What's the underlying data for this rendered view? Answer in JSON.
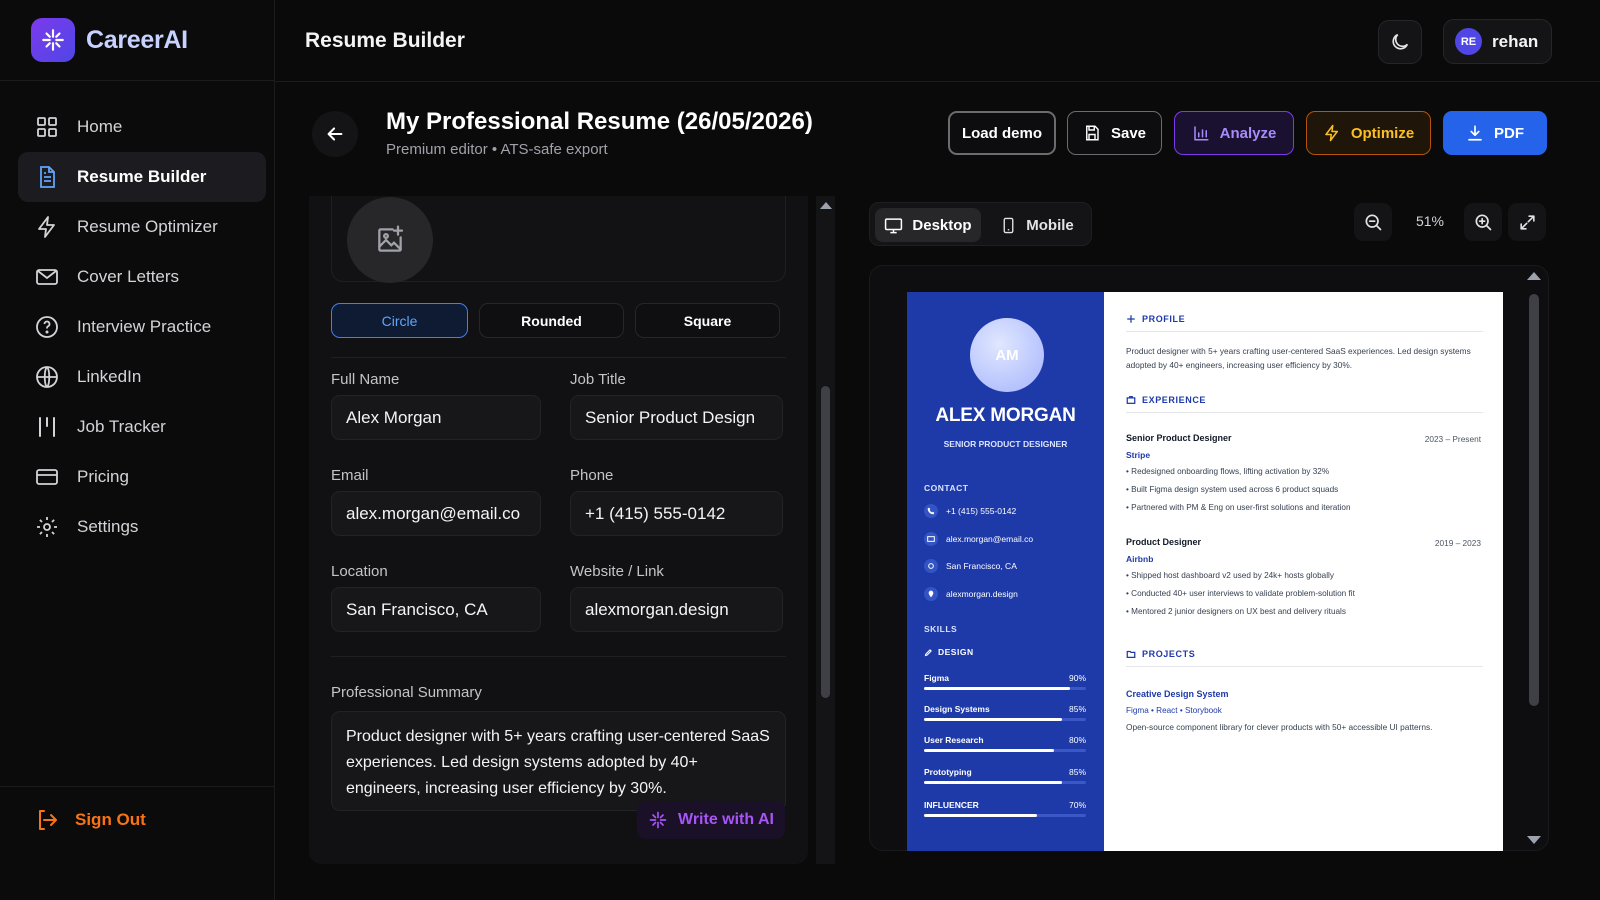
{
  "app": {
    "name": "CareerAI"
  },
  "sidebar": {
    "items": [
      {
        "label": "Home",
        "icon": "grid-icon"
      },
      {
        "label": "Resume Builder",
        "icon": "document-icon",
        "active": true
      },
      {
        "label": "Resume Optimizer",
        "icon": "lightning-icon"
      },
      {
        "label": "Cover Letters",
        "icon": "mail-icon"
      },
      {
        "label": "Interview Practice",
        "icon": "help-circle-icon"
      },
      {
        "label": "LinkedIn",
        "icon": "globe-icon"
      },
      {
        "label": "Job Tracker",
        "icon": "columns-icon"
      },
      {
        "label": "Pricing",
        "icon": "credit-card-icon"
      },
      {
        "label": "Settings",
        "icon": "gear-icon"
      }
    ],
    "sign_out": "Sign Out"
  },
  "header": {
    "title": "Resume Builder",
    "user": {
      "initials": "RE",
      "name": "rehan"
    }
  },
  "doc": {
    "title": "My Professional Resume (26/05/2026)",
    "subtitle": "Premium editor • ATS-safe export"
  },
  "actions": {
    "load_demo": "Load demo",
    "save": "Save",
    "analyze": "Analyze",
    "optimize": "Optimize",
    "pdf": "PDF"
  },
  "editor": {
    "photo_shapes": [
      "Circle",
      "Rounded",
      "Square"
    ],
    "selected_shape": "Circle",
    "fields": {
      "full_name": {
        "label": "Full Name",
        "value": "Alex Morgan"
      },
      "job_title": {
        "label": "Job Title",
        "value": "Senior Product Design"
      },
      "email": {
        "label": "Email",
        "value": "alex.morgan@email.co"
      },
      "phone": {
        "label": "Phone",
        "value": "+1 (415) 555-0142"
      },
      "location": {
        "label": "Location",
        "value": "San Francisco, CA"
      },
      "website": {
        "label": "Website / Link",
        "value": "alexmorgan.design"
      }
    },
    "summary": {
      "label": "Professional Summary",
      "value": "Product designer with 5+ years crafting user-centered SaaS experiences. Led design systems adopted by 40+ engineers, increasing user efficiency by 30%."
    },
    "write_ai": "Write with AI"
  },
  "preview": {
    "modes": [
      "Desktop",
      "Mobile"
    ],
    "active_mode": "Desktop",
    "zoom": "51%"
  },
  "resume": {
    "initials": "AM",
    "name": "ALEX MORGAN",
    "title": "SENIOR PRODUCT DESIGNER",
    "contact_heading": "CONTACT",
    "contacts": [
      {
        "icon": "phone-icon",
        "text": "+1 (415) 555-0142"
      },
      {
        "icon": "mail-icon",
        "text": "alex.morgan@email.co"
      },
      {
        "icon": "location-icon",
        "text": "San Francisco, CA"
      },
      {
        "icon": "link-icon",
        "text": "alexmorgan.design"
      }
    ],
    "skills_heading": "SKILLS",
    "skill_group": "DESIGN",
    "skills": [
      {
        "name": "Figma",
        "pct": "90%",
        "level": 0.9
      },
      {
        "name": "Design Systems",
        "pct": "85%",
        "level": 0.85
      },
      {
        "name": "User Research",
        "pct": "80%",
        "level": 0.8
      },
      {
        "name": "Prototyping",
        "pct": "85%",
        "level": 0.85
      },
      {
        "name": "INFLUENCER",
        "pct": "70%",
        "level": 0.7
      }
    ],
    "profile_heading": "PROFILE",
    "profile_text": "Product designer with 5+ years crafting user-centered SaaS experiences. Led design systems adopted by 40+ engineers, increasing user efficiency by 30%.",
    "experience_heading": "EXPERIENCE",
    "jobs": [
      {
        "title": "Senior Product Designer",
        "dates": "2023 – Present",
        "company": "Stripe",
        "bullets": [
          "Redesigned onboarding flows, lifting activation by 32%",
          "Built Figma design system used across 6 product squads",
          "Partnered with PM & Eng on user-first solutions and iteration"
        ]
      },
      {
        "title": "Product Designer",
        "dates": "2019 – 2023",
        "company": "Airbnb",
        "bullets": [
          "Shipped host dashboard v2 used by 24k+ hosts globally",
          "Conducted 40+ user interviews to validate problem-solution fit",
          "Mentored 2 junior designers on UX best and delivery rituals"
        ]
      }
    ],
    "projects_heading": "PROJECTS",
    "project": {
      "name": "Creative Design System",
      "stack": "Figma • React • Storybook",
      "description": "Open-source component library for clever products with 50+ accessible UI patterns."
    }
  },
  "colors": {
    "accent_blue": "#2563eb",
    "resume_blue": "#1e3aa8",
    "analyze_purple": "#a78bfa",
    "optimize_amber": "#fbbf24",
    "signout_orange": "#f97316"
  }
}
